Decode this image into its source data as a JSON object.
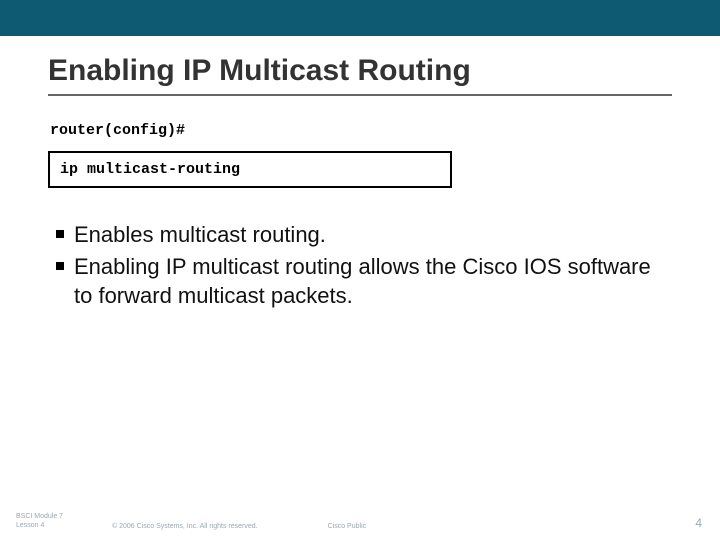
{
  "title": "Enabling IP Multicast Routing",
  "prompt": "router(config)#",
  "command": "ip multicast-routing",
  "bullets": [
    "Enables multicast routing.",
    "Enabling IP multicast routing allows the Cisco IOS software to forward multicast packets."
  ],
  "footer": {
    "lesson_line1": "BSCI Module 7",
    "lesson_line2": "Lesson 4",
    "copyright": "© 2006 Cisco Systems, Inc. All rights reserved.",
    "cisco_public": "Cisco Public",
    "page_number": "4"
  }
}
